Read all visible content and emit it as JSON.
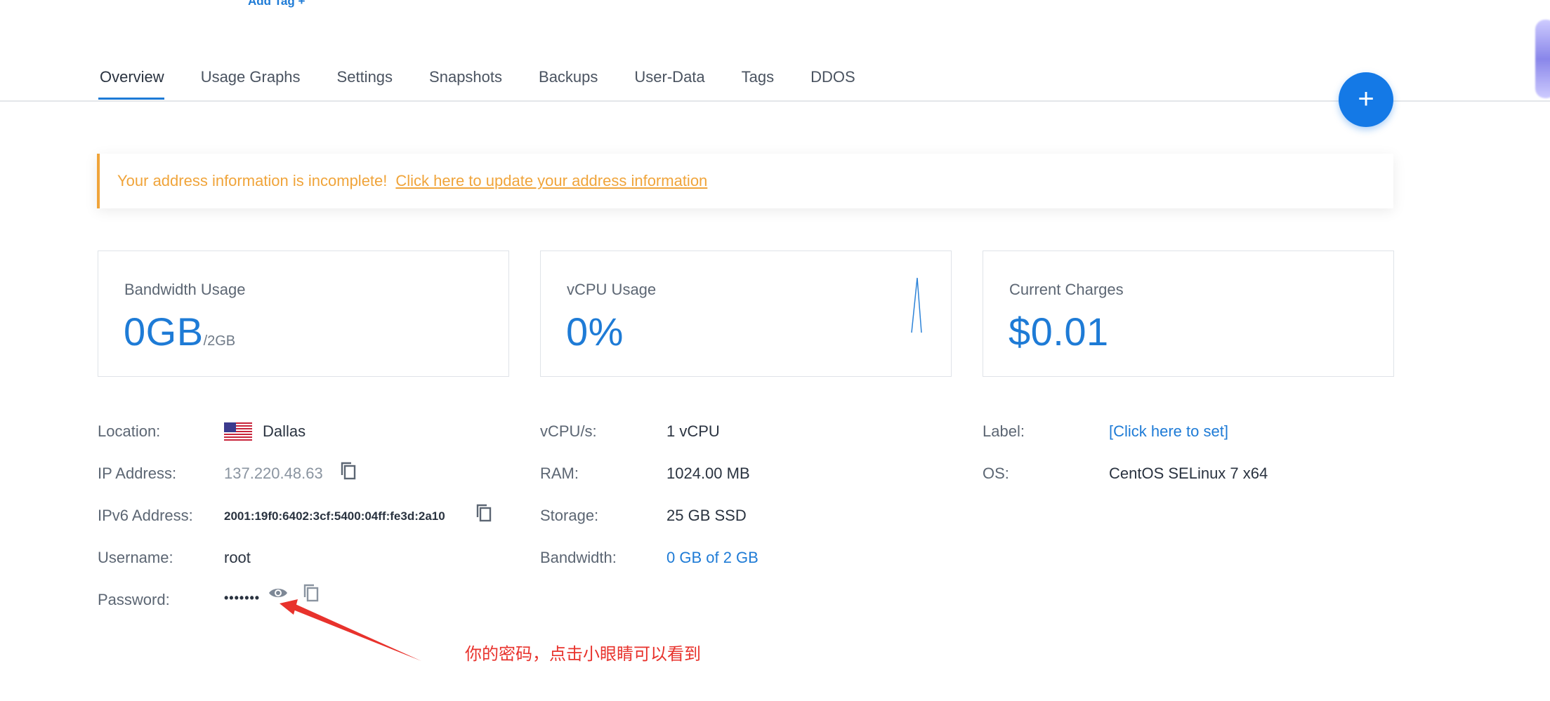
{
  "top": {
    "add_tag": "Add Tag +"
  },
  "tabs": [
    {
      "label": "Overview",
      "active": true
    },
    {
      "label": "Usage Graphs"
    },
    {
      "label": "Settings"
    },
    {
      "label": "Snapshots"
    },
    {
      "label": "Backups"
    },
    {
      "label": "User-Data"
    },
    {
      "label": "Tags"
    },
    {
      "label": "DDOS"
    }
  ],
  "fab": {
    "label": "+"
  },
  "alert": {
    "text": "Your address information is incomplete!",
    "link": "Click here to update your address information",
    "color": "#f0a43a"
  },
  "cards": {
    "bandwidth": {
      "label": "Bandwidth Usage",
      "value": "0GB",
      "limit": "/2GB"
    },
    "vcpu": {
      "label": "vCPU Usage",
      "value": "0%"
    },
    "charges": {
      "label": "Current Charges",
      "value": "$0.01"
    }
  },
  "details": {
    "location": {
      "key": "Location:",
      "value": "Dallas",
      "flag": "us-flag-icon"
    },
    "ip": {
      "key": "IP Address:",
      "value": "137.220.48.63"
    },
    "ipv6": {
      "key": "IPv6 Address:",
      "value": "2001:19f0:6402:3cf:5400:04ff:fe3d:2a10"
    },
    "username": {
      "key": "Username:",
      "value": "root"
    },
    "password": {
      "key": "Password:",
      "value": "•••••••"
    },
    "vcpus": {
      "key": "vCPU/s:",
      "value": "1 vCPU"
    },
    "ram": {
      "key": "RAM:",
      "value": "1024.00 MB"
    },
    "storage": {
      "key": "Storage:",
      "value": "25 GB SSD"
    },
    "bandwidth": {
      "key": "Bandwidth:",
      "value": "0 GB of 2 GB"
    },
    "label": {
      "key": "Label:",
      "value": "[Click here to set]"
    },
    "os": {
      "key": "OS:",
      "value": "CentOS SELinux 7 x64"
    }
  },
  "annotation": {
    "text": "你的密码，点击小眼睛可以看到",
    "color": "#e8322c"
  },
  "colors": {
    "accent": "#1e7bd6",
    "fab": "#1479e6"
  }
}
